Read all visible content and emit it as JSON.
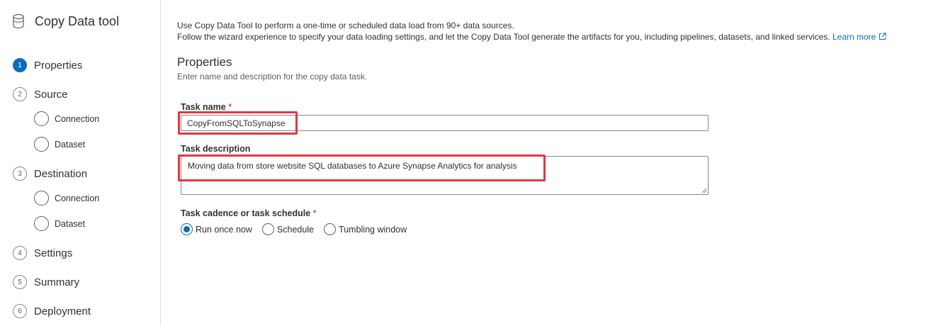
{
  "sidebar": {
    "title": "Copy Data tool",
    "title_icon": "database-icon",
    "steps": [
      {
        "num": "1",
        "label": "Properties",
        "active": true
      },
      {
        "num": "2",
        "label": "Source"
      },
      {
        "num": "3",
        "label": "Destination"
      },
      {
        "num": "4",
        "label": "Settings"
      },
      {
        "num": "5",
        "label": "Summary"
      },
      {
        "num": "6",
        "label": "Deployment"
      }
    ],
    "source_substeps": [
      "Connection",
      "Dataset"
    ],
    "destination_substeps": [
      "Connection",
      "Dataset"
    ]
  },
  "intro": {
    "line1": "Use Copy Data Tool to perform a one-time or scheduled data load from 90+ data sources.",
    "line2": "Follow the wizard experience to specify your data loading settings, and let the Copy Data Tool generate the artifacts for you, including pipelines, datasets, and linked services.",
    "learn_more": "Learn more"
  },
  "properties": {
    "title": "Properties",
    "description": "Enter name and description for the copy data task.",
    "task_name_label": "Task name",
    "task_name_value": "CopyFromSQLToSynapse",
    "task_description_label": "Task description",
    "task_description_value": "Moving data from store website SQL databases to Azure Synapse Analytics for analysis",
    "cadence_label": "Task cadence or task schedule",
    "required_mark": "*",
    "cadence_options": [
      "Run once now",
      "Schedule",
      "Tumbling window"
    ],
    "cadence_selected": "Run once now"
  },
  "colors": {
    "accent": "#0f6cbd",
    "highlight": "#e0383f",
    "required": "#a4262c"
  }
}
